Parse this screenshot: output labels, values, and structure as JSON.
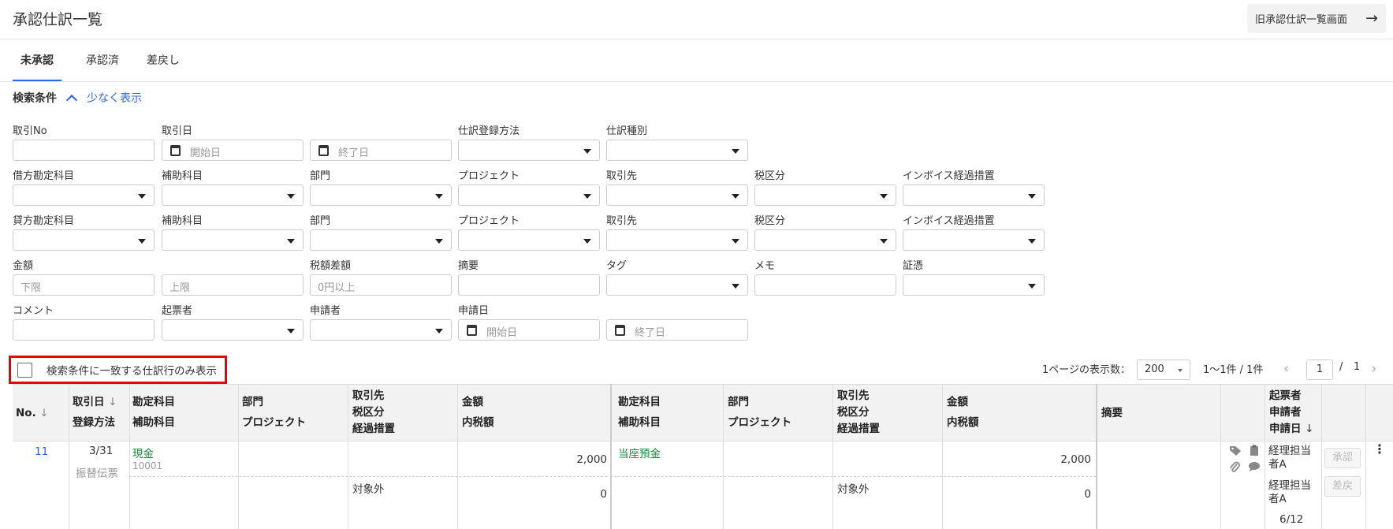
{
  "header": {
    "title": "承認仕訳一覧",
    "old_list_button": "旧承認仕訳一覧画面"
  },
  "tabs": [
    "未承認",
    "承認済",
    "差戻し"
  ],
  "search": {
    "title": "検索条件",
    "toggle_label": "少なく表示",
    "fields": {
      "transaction_no": "取引No",
      "transaction_date": "取引日",
      "date_start_placeholder": "開始日",
      "date_end_placeholder": "終了日",
      "registration_method": "仕訳登録方法",
      "journal_type": "仕訳種別",
      "debit_account": "借方勘定科目",
      "credit_account": "貸方勘定科目",
      "sub_account": "補助科目",
      "department": "部門",
      "project": "プロジェクト",
      "partner": "取引先",
      "tax_category": "税区分",
      "invoice_measure": "インボイス経過措置",
      "amount": "金額",
      "amount_min_placeholder": "下限",
      "amount_max_placeholder": "上限",
      "tax_diff": "税額差額",
      "tax_diff_placeholder": "0円以上",
      "summary": "摘要",
      "tag": "タグ",
      "memo": "メモ",
      "evidence": "証憑",
      "comment": "コメント",
      "drafter": "起票者",
      "applicant": "申請者",
      "application_date": "申請日"
    }
  },
  "filter_checkbox": "検索条件に一致する仕訳行のみ表示",
  "pagination": {
    "per_page_label": "1ページの表示数：",
    "per_page": "200",
    "range": "1〜1件 / 1件",
    "current_page": "1",
    "separator": "/",
    "total_pages": "1"
  },
  "table": {
    "headers": {
      "no": "No.",
      "date": "取引日",
      "reg_method": "登録方法",
      "account": "勘定科目",
      "sub_account": "補助科目",
      "department": "部門",
      "project": "プロジェクト",
      "partner": "取引先",
      "tax_category": "税区分",
      "measure": "経過措置",
      "amount": "金額",
      "tax_included": "内税額",
      "summary": "摘要",
      "drafter": "起票者",
      "applicant": "申請者",
      "app_date": "申請日"
    },
    "row": {
      "no": "11",
      "date": "3/31",
      "method": "振替伝票",
      "debit_account": "現金",
      "debit_sub_code": "10001",
      "debit_amount": "2,000",
      "debit_tax_category": "対象外",
      "debit_tax": "0",
      "credit_account": "当座預金",
      "credit_amount": "2,000",
      "credit_tax_category": "対象外",
      "credit_tax": "0",
      "drafter": "経理担当者A",
      "applicant": "経理担当者A",
      "app_date": "6/12",
      "approve_label": "承認",
      "reject_label": "差戻"
    }
  }
}
